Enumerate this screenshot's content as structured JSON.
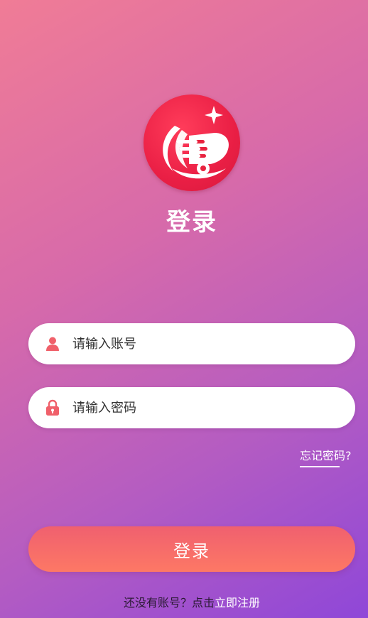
{
  "page": {
    "title": "登录"
  },
  "login_form": {
    "account_placeholder": "请输入账号",
    "password_placeholder": "请输入密码",
    "account_value": "",
    "password_value": "",
    "forgot_password": "忘记密码?",
    "submit_label": "登录"
  },
  "register": {
    "prompt": "还没有账号？点击",
    "link": "立即注册"
  },
  "icons": {
    "logo": "delivery-logo-icon",
    "account": "user-icon",
    "password": "lock-icon"
  },
  "colors": {
    "logo_red": "#e8233f",
    "icon_accent": "#f0606a",
    "button_gradient_top": "#f0606f",
    "button_gradient_bottom": "#fd7865"
  }
}
